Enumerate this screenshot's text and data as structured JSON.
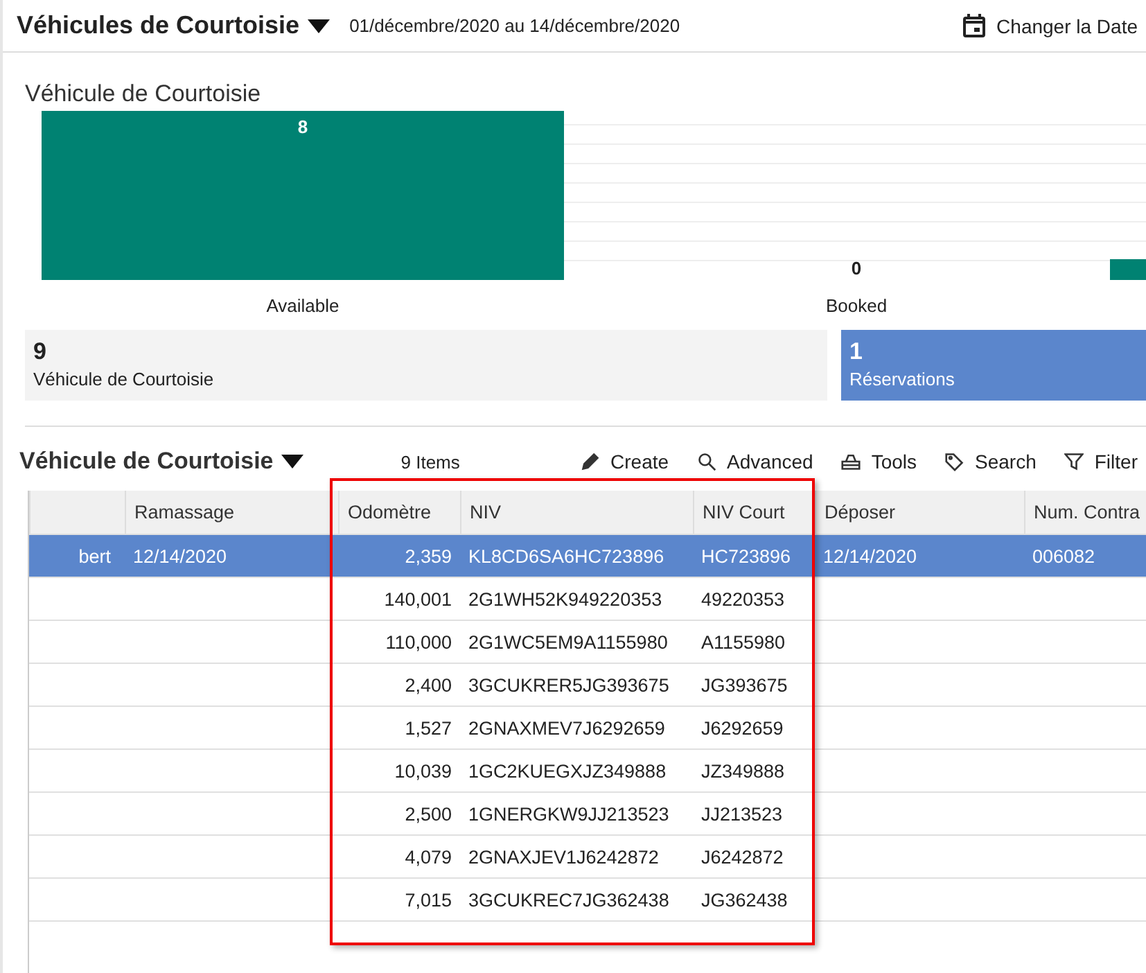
{
  "header": {
    "title": "Véhicules de Courtoisie",
    "date_range": "01/décembre/2020 au 14/décembre/2020",
    "change_date": "Changer la Date"
  },
  "chart": {
    "title": "Véhicule de Courtoisie",
    "chart_data": {
      "type": "bar",
      "categories": [
        "Available",
        "Booked"
      ],
      "values": [
        8,
        0
      ],
      "data_labels": true,
      "color": "#008272"
    }
  },
  "tiles": [
    {
      "value": "9",
      "label": "Véhicule de Courtoisie",
      "selected": false
    },
    {
      "value": "1",
      "label": "Réservations",
      "selected": true
    }
  ],
  "list": {
    "title": "Véhicule de Courtoisie",
    "count": "9 Items",
    "actions": [
      "Create",
      "Advanced",
      "Tools",
      "Search",
      "Filter"
    ]
  },
  "table": {
    "columns": [
      "",
      "Ramassage",
      "Odomètre",
      "NIV",
      "NIV Court",
      "Déposer",
      "Num. Contra"
    ],
    "rows": [
      {
        "selected": true,
        "cells": [
          "bert",
          "12/14/2020",
          "2,359",
          "KL8CD6SA6HC723896",
          "HC723896",
          "12/14/2020",
          "006082"
        ]
      },
      {
        "selected": false,
        "cells": [
          "",
          "",
          "140,001",
          "2G1WH52K949220353",
          "49220353",
          "",
          ""
        ]
      },
      {
        "selected": false,
        "cells": [
          "",
          "",
          "110,000",
          "2G1WC5EM9A1155980",
          "A1155980",
          "",
          ""
        ]
      },
      {
        "selected": false,
        "cells": [
          "",
          "",
          "2,400",
          "3GCUKRER5JG393675",
          "JG393675",
          "",
          ""
        ]
      },
      {
        "selected": false,
        "cells": [
          "",
          "",
          "1,527",
          "2GNAXMEV7J6292659",
          "J6292659",
          "",
          ""
        ]
      },
      {
        "selected": false,
        "cells": [
          "",
          "",
          "10,039",
          "1GC2KUEGXJZ349888",
          "JZ349888",
          "",
          ""
        ]
      },
      {
        "selected": false,
        "cells": [
          "",
          "",
          "2,500",
          "1GNERGKW9JJ213523",
          "JJ213523",
          "",
          ""
        ]
      },
      {
        "selected": false,
        "cells": [
          "",
          "",
          "4,079",
          "2GNAXJEV1J6242872",
          "J6242872",
          "",
          ""
        ]
      },
      {
        "selected": false,
        "cells": [
          "",
          "",
          "7,015",
          "3GCUKREC7JG362438",
          "JG362438",
          "",
          ""
        ]
      }
    ]
  }
}
